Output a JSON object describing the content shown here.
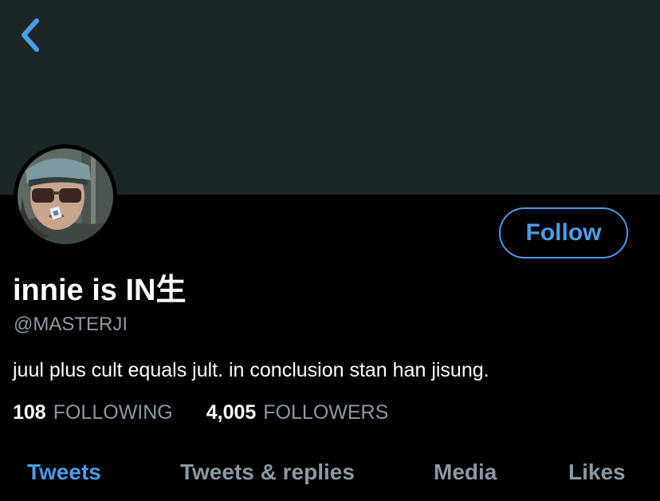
{
  "header": {
    "back_icon": "chevron-left-icon",
    "banner_color": "#1b2727"
  },
  "profile": {
    "display_name": "innie is IN生",
    "handle": "@MASTERJI",
    "bio": "juul plus cult equals jult. in conclusion stan han jisung.",
    "avatar_icon": "profile-photo"
  },
  "actions": {
    "follow_label": "Follow"
  },
  "stats": {
    "following_count": "108",
    "following_label": "FOLLOWING",
    "followers_count": "4,005",
    "followers_label": "FOLLOWERS"
  },
  "tabs": [
    {
      "label": "Tweets",
      "active": true
    },
    {
      "label": "Tweets & replies",
      "active": false
    },
    {
      "label": "Media",
      "active": false
    },
    {
      "label": "Likes",
      "active": false
    }
  ],
  "colors": {
    "accent": "#4a9ce8",
    "muted": "#8b98a5",
    "background": "#000000"
  }
}
